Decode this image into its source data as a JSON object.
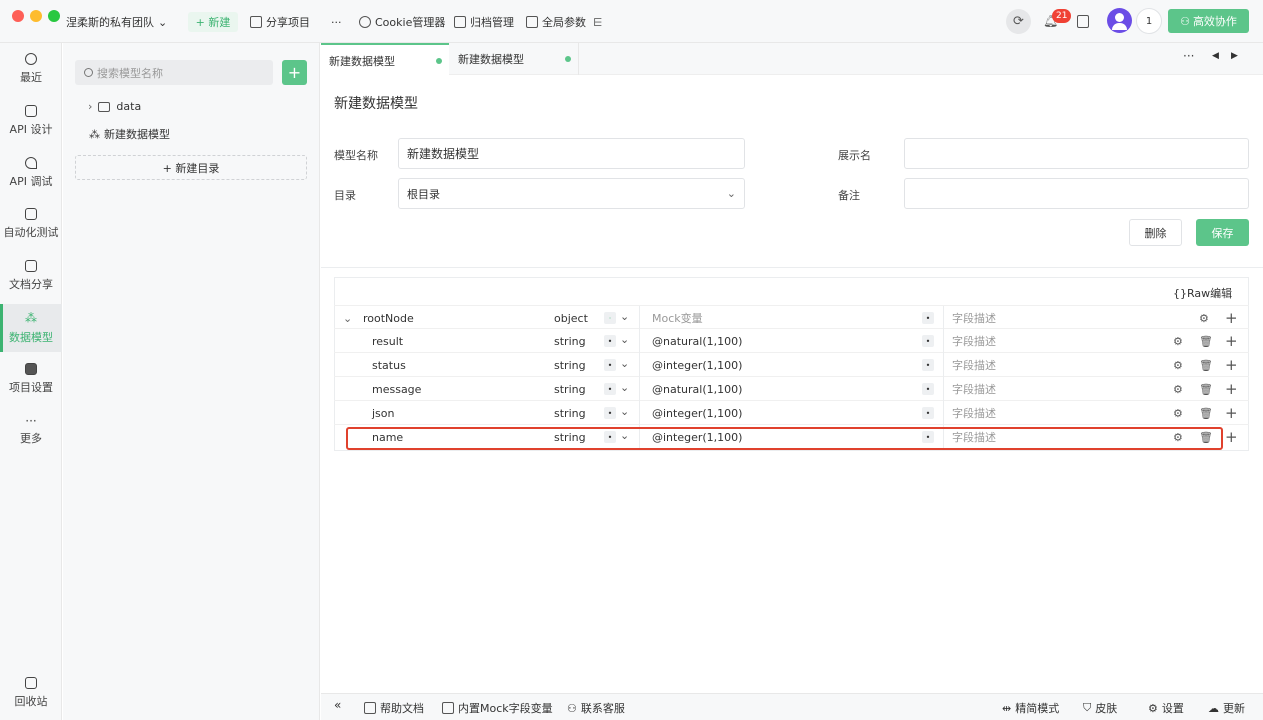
{
  "titlebar": {
    "team_name": "涅柔斯的私有团队",
    "new_label": "+ 新建",
    "share_label": "分享项目",
    "more_label": "···",
    "cookie_label": "Cookie管理器",
    "archive_label": "归档管理",
    "global_params_label": "全局参数",
    "notification_count": "21",
    "user_count": "1",
    "collab_label": "高效协作"
  },
  "leftnav": {
    "items": [
      {
        "label": "最近",
        "icon": "clock-icon"
      },
      {
        "label": "API 设计",
        "icon": "edit-icon"
      },
      {
        "label": "API 调试",
        "icon": "rocket-icon"
      },
      {
        "label": "自动化测试",
        "icon": "flow-icon"
      },
      {
        "label": "文档分享",
        "icon": "doc-icon"
      },
      {
        "label": "数据模型",
        "icon": "model-icon"
      },
      {
        "label": "项目设置",
        "icon": "folder-gear-icon"
      },
      {
        "label": "更多",
        "icon": "more-icon"
      }
    ],
    "recycle_label": "回收站"
  },
  "tree": {
    "search_placeholder": "搜索模型名称",
    "folder_label": "data",
    "model_label": "新建数据模型",
    "new_dir_label": "+ 新建目录"
  },
  "tabs": [
    {
      "label": "新建数据模型"
    },
    {
      "label": "新建数据模型"
    }
  ],
  "form": {
    "title": "新建数据模型",
    "model_name_label": "模型名称",
    "model_name_value": "新建数据模型",
    "display_name_label": "展示名",
    "display_name_value": "",
    "dir_label": "目录",
    "dir_value": "根目录",
    "remark_label": "备注",
    "remark_value": "",
    "delete_label": "删除",
    "save_label": "保存"
  },
  "schema": {
    "raw_edit_label": "{}Raw编辑",
    "mock_placeholder": "Mock变量",
    "desc_placeholder": "字段描述",
    "rows": [
      {
        "name": "rootNode",
        "type": "object",
        "mock": ""
      },
      {
        "name": "result",
        "type": "string",
        "mock": "@natural(1,100)"
      },
      {
        "name": "status",
        "type": "string",
        "mock": "@integer(1,100)"
      },
      {
        "name": "message",
        "type": "string",
        "mock": "@natural(1,100)"
      },
      {
        "name": "json",
        "type": "string",
        "mock": "@integer(1,100)"
      },
      {
        "name": "name",
        "type": "string",
        "mock": "@integer(1,100)"
      }
    ]
  },
  "bottombar": {
    "help_label": "帮助文档",
    "mock_label": "内置Mock字段变量",
    "support_label": "联系客服",
    "simple_mode_label": "精简模式",
    "skin_label": "皮肤",
    "settings_label": "设置",
    "update_label": "更新"
  },
  "colors": {
    "accent": "#5cc58a",
    "highlight": "#e0412d",
    "badge": "#f04134"
  }
}
